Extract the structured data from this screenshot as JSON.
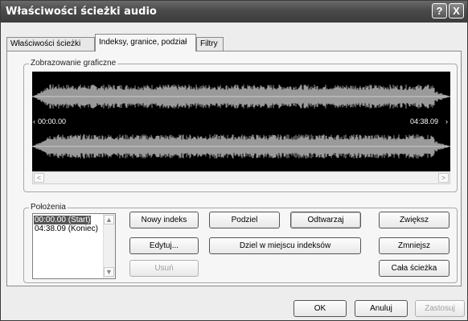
{
  "window": {
    "title": "Właściwości ścieżki audio",
    "help_glyph": "?",
    "close_glyph": "X"
  },
  "tabs": [
    {
      "label": "Właściwości ścieżki",
      "active": false
    },
    {
      "label": "Indeksy, granice, podział",
      "active": true
    },
    {
      "label": "Filtry",
      "active": false
    }
  ],
  "graphic": {
    "group_label": "Zobrazowanie graficzne",
    "time_start": "00:00.00",
    "time_end": "04:38.09",
    "scroll_left": "<",
    "scroll_right": ">"
  },
  "positions": {
    "group_label": "Położenia",
    "items": [
      {
        "label": "00:00.00 (Start)",
        "selected": true
      },
      {
        "label": "04:38.09 (Koniec)",
        "selected": false
      }
    ]
  },
  "buttons": {
    "new_index": "Nowy indeks",
    "edit": "Edytuj...",
    "remove": "Usuń",
    "split": "Podziel",
    "split_at_indexes": "Dziel w miejscu indeksów",
    "play": "Odtwarzaj",
    "zoom_in": "Zwiększ",
    "zoom_out": "Zmniejsz",
    "whole_track": "Cała ścieżka"
  },
  "footer": {
    "ok": "OK",
    "cancel": "Anuluj",
    "apply": "Zastosuj"
  },
  "colors": {
    "waveform": "#9a9a9a",
    "waveform_bg": "#000000",
    "title_bar": "#4a4a4a"
  }
}
